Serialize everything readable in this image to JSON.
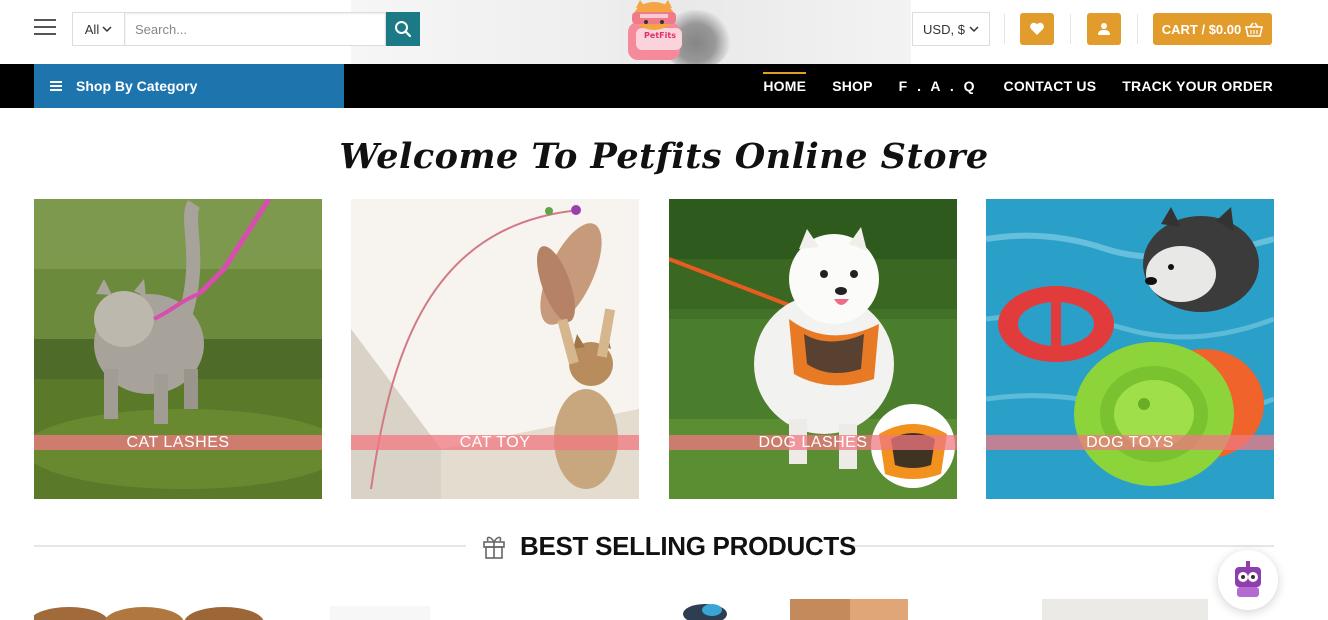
{
  "header": {
    "search_category": "All",
    "search_placeholder": "Search...",
    "logo_text": "PetFits",
    "currency": "USD, $",
    "cart_label": "CART / $0.00"
  },
  "nav": {
    "shop_by_category": "Shop By Category",
    "links": [
      {
        "label": "HOME",
        "active": true
      },
      {
        "label": "SHOP",
        "active": false
      },
      {
        "label": "F . A . Q",
        "active": false
      },
      {
        "label": "CONTACT US",
        "active": false
      },
      {
        "label": "TRACK YOUR ORDER",
        "active": false
      }
    ]
  },
  "main": {
    "welcome_title": "Welcome To Petfits Online Store",
    "categories": [
      {
        "label": "CAT LASHES",
        "icon": "cat-on-leash"
      },
      {
        "label": "CAT TOY",
        "icon": "kitten-with-feather-wand"
      },
      {
        "label": "DOG LASHES",
        "icon": "white-dog-with-harness"
      },
      {
        "label": "DOG TOYS",
        "icon": "dog-swimming-with-frisbees"
      }
    ],
    "best_selling_title": "BEST SELLING PRODUCTS"
  },
  "colors": {
    "accent": "#e29c2b",
    "nav_bg": "#000000",
    "category_bg": "#1e74ad",
    "search_button": "#1b7a85",
    "category_label_bg": "#f07882"
  }
}
